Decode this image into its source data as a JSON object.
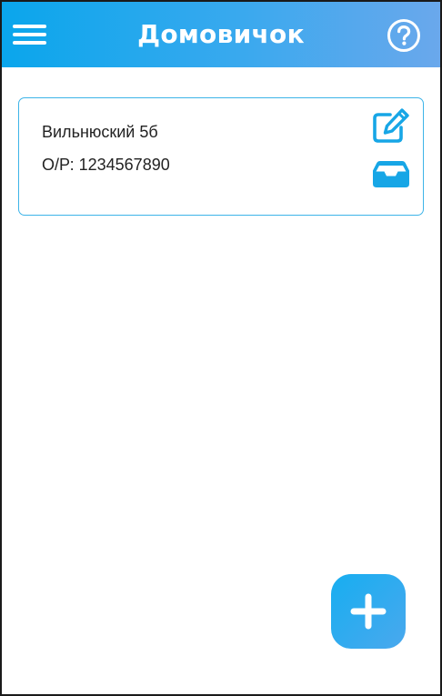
{
  "app": {
    "title": "Домовичок"
  },
  "header": {
    "menu_icon": "hamburger-menu-icon",
    "help_icon": "question-circle-icon"
  },
  "property_card": {
    "address": "Вильнюский 5б",
    "account": "О/Р: 1234567890",
    "edit_icon": "edit-icon",
    "inbox_icon": "inbox-icon"
  },
  "fab": {
    "icon": "plus-icon"
  },
  "colors": {
    "header_gradient_start": "#0aa6ec",
    "header_gradient_end": "#6aa8ec",
    "accent": "#17a6e6",
    "card_border": "#3db4e8",
    "text": "#222222",
    "background": "#ffffff"
  }
}
